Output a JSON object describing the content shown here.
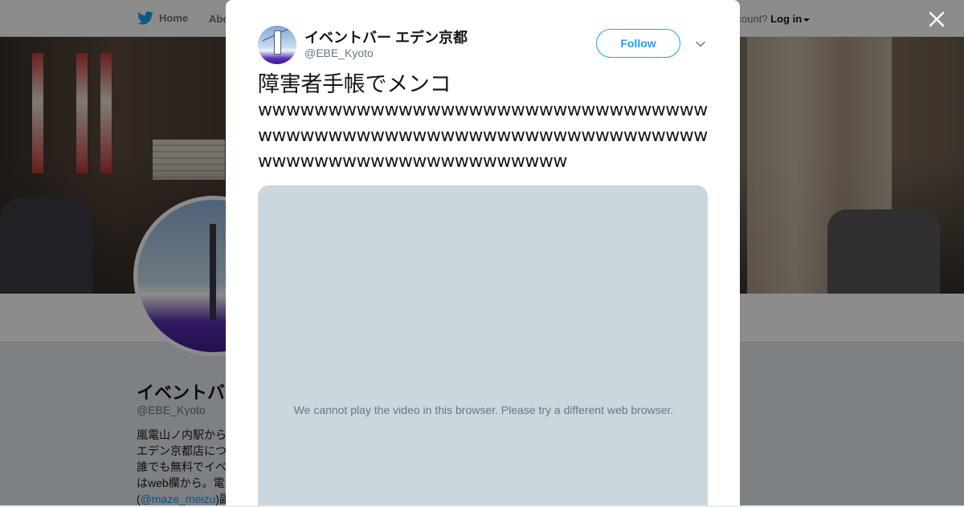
{
  "background_page": {
    "nav": {
      "home_label": "Home",
      "about_label": "Abo",
      "account_prompt": "ccount?",
      "login_label": "Log in"
    },
    "profile": {
      "name": "イベントバ",
      "handle": "@EBE_Kyoto",
      "bio_lines": [
        "嵐電山ノ内駅から",
        "エデン京都店につ",
        "誰でも無料でイベ",
        "はweb欄から。電"
      ],
      "bio_last_prefix": "(",
      "bio_link": "@maze_meizu",
      "bio_last_suffix": ")副"
    }
  },
  "modal": {
    "author_name": "イベントバー エデン京都",
    "author_handle": "@EBE_Kyoto",
    "follow_label": "Follow",
    "tweet_lines": [
      "障害者手帳でメンコ",
      "wwwwwwwwwwwwwwwwwwwwwwwwwwwwwwww",
      "wwwwwwwwwwwwwwwwwwwwwwwwwwwwwwww",
      "wwwwwwwwwwwwwwwwwwwwww"
    ],
    "video_message": "We cannot play the video in this browser. Please try a different web browser."
  },
  "icons": {
    "brand": "twitter-bird-icon",
    "close": "close-icon",
    "caret": "chevron-down-icon"
  },
  "colors": {
    "accent": "#1da1f2",
    "text": "#14171a",
    "muted": "#657786",
    "video_placeholder": "#ccd6dd"
  }
}
